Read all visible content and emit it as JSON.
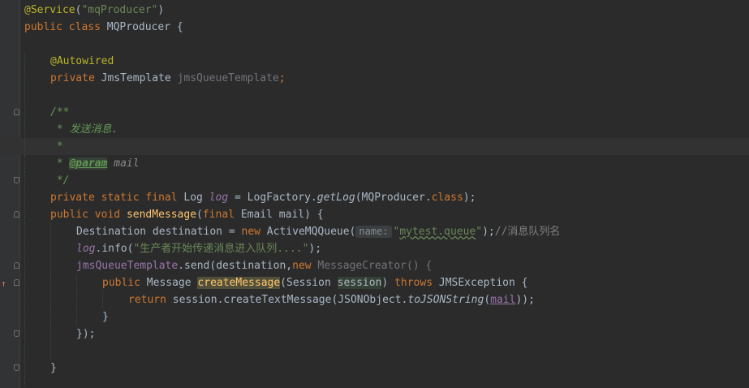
{
  "editor": {
    "annotation_service": "@Service",
    "producer_name": "\"mqProducer\"",
    "class_decl": {
      "kw_public": "public",
      "kw_class": "class",
      "name": "MQProducer",
      "brace": "{"
    },
    "autowired": "@Autowired",
    "template_field": {
      "kw_private": "private",
      "type": "JmsTemplate",
      "name": "jmsQueueTemplate",
      "semi": ";"
    },
    "javadoc": {
      "open": "/**",
      "desc": " * 发送消息.",
      "star": " *",
      "param_prefix": " * ",
      "param_tag": "@param",
      "param_name": " mail",
      "close": " */"
    },
    "log_line": {
      "kw_private": "private",
      "kw_static": "static",
      "kw_final": "final",
      "type": "Log",
      "name": "log",
      "assign": " = LogFactory.",
      "call": "getLog",
      "arg": "(MQProducer.",
      "kw_class": "class",
      "end": ");"
    },
    "method_sig": {
      "kw_public": "public",
      "kw_void": "void",
      "name": "sendMessage",
      "open": "(",
      "kw_final": "final",
      "params": " Email mail) {"
    },
    "dest_line": {
      "decl": "Destination destination = ",
      "kw_new": "new",
      "ctor": " ActiveMQQueue(",
      "hint": "name:",
      "q_open": "\"",
      "queue": "mytest.queue",
      "q_close": "\"",
      "end": ");",
      "comment": "//消息队列名"
    },
    "log_info": {
      "field": "log",
      "call": ".info(",
      "str": "\"生产者开始传递消息进入队列....\"",
      "end": ");"
    },
    "send_line": {
      "field": "jmsQueueTemplate",
      "call": ".send(destination,",
      "kw_new": "new",
      "anon": " MessageCreator() {",
      "brace": ""
    },
    "create_msg": {
      "kw_public": "public",
      "type": " Message ",
      "name": "createMessage",
      "params_open": "(Session ",
      "param": "session",
      "params_close": ") ",
      "kw_throws": "throws",
      "ex": " JMSException {"
    },
    "return_line": {
      "kw_return": "return",
      "expr": " session.createTextMessage(JSONObject.",
      "call": "toJSONString",
      "open": "(",
      "arg": "mail",
      "end": "));"
    },
    "close_inner": "}",
    "close_send": "});",
    "close_method": "}"
  }
}
